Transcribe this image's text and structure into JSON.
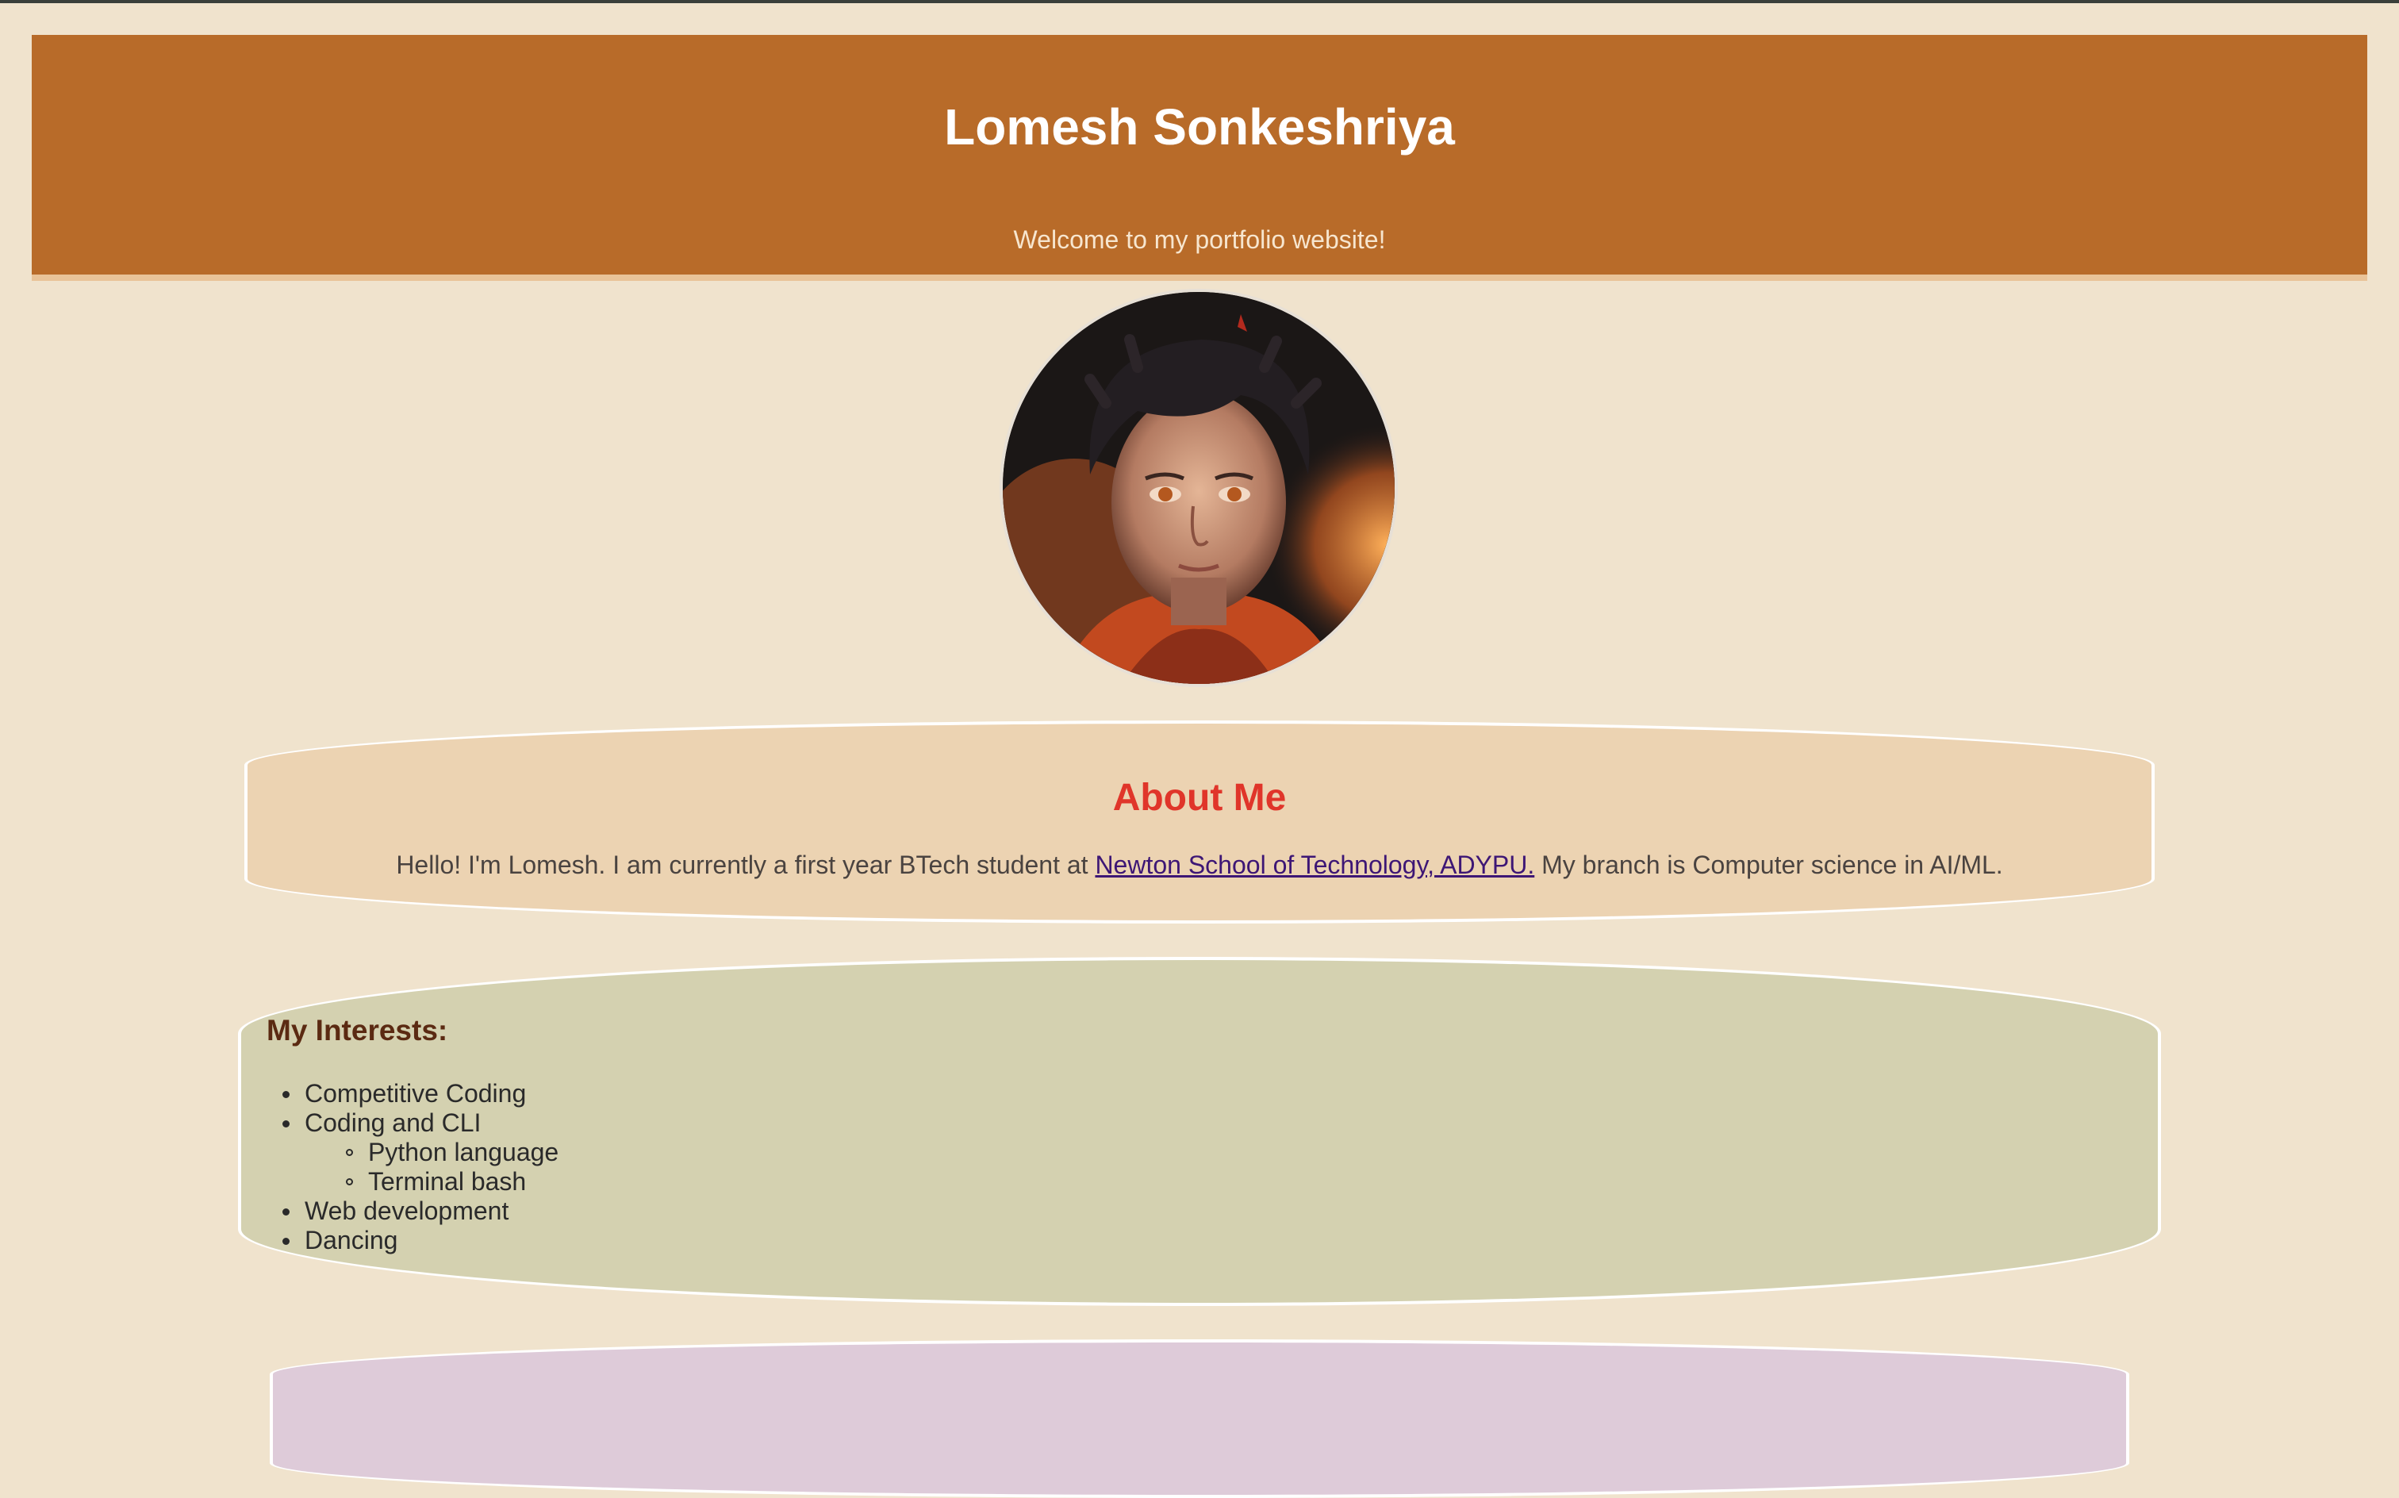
{
  "header": {
    "title": "Lomesh Sonkeshriya",
    "subtitle": "Welcome to my portfolio website!"
  },
  "colors": {
    "page_bg": "#f0e3cd",
    "header_bg": "#b86b29",
    "about_bg": "#ecd3b2",
    "about_heading": "#e0352a",
    "link": "#3d1675",
    "interests_bg": "#d4d1b0",
    "interests_heading": "#5b2a12",
    "next_section_bg": "#decbd9"
  },
  "profile": {
    "image_alt": "profile picture"
  },
  "about": {
    "heading": "About Me",
    "text_before": "Hello! I'm Lomesh. I am currently a first year BTech student at ",
    "link_text": "Newton School of Technology, ADYPU.",
    "text_after": " My branch is Computer science in AI/ML."
  },
  "interests": {
    "heading": "My Interests:",
    "items": [
      {
        "label": "Competitive Coding",
        "sub": []
      },
      {
        "label": "Coding and CLI",
        "sub": [
          "Python language",
          "Terminal bash"
        ]
      },
      {
        "label": "Web development",
        "sub": []
      },
      {
        "label": "Dancing",
        "sub": []
      }
    ]
  }
}
